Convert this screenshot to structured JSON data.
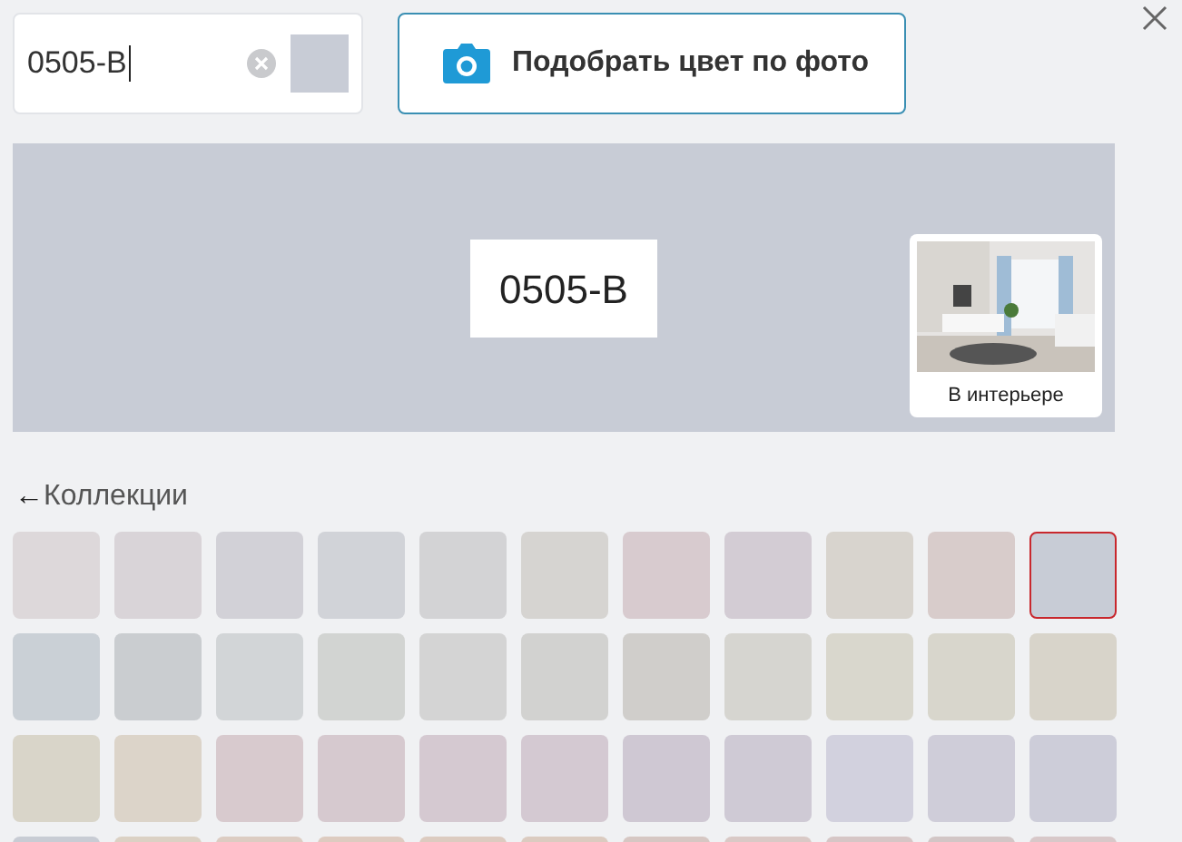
{
  "search": {
    "value": "0505-B"
  },
  "photo_button": {
    "label": "Подобрать цвет по фото"
  },
  "preview": {
    "color": "#c8ccd6",
    "code": "0505-B",
    "interior_label": "В интерьере"
  },
  "back_link": {
    "arrow": "←",
    "label": "Коллекции"
  },
  "swatches": [
    {
      "color": "#ddd8da",
      "selected": false
    },
    {
      "color": "#d9d4d8",
      "selected": false
    },
    {
      "color": "#d2d1d7",
      "selected": false
    },
    {
      "color": "#d1d3d8",
      "selected": false
    },
    {
      "color": "#d3d3d5",
      "selected": false
    },
    {
      "color": "#d6d4d1",
      "selected": false
    },
    {
      "color": "#d8cbcf",
      "selected": false
    },
    {
      "color": "#d3ccd4",
      "selected": false
    },
    {
      "color": "#d8d4ce",
      "selected": false
    },
    {
      "color": "#d8cccb",
      "selected": false
    },
    {
      "color": "#c8ccd6",
      "selected": true
    },
    {
      "color": "#cad0d6",
      "selected": false
    },
    {
      "color": "#cacdd0",
      "selected": false
    },
    {
      "color": "#d2d5d7",
      "selected": false
    },
    {
      "color": "#d2d4d2",
      "selected": false
    },
    {
      "color": "#d4d4d4",
      "selected": false
    },
    {
      "color": "#d2d2d0",
      "selected": false
    },
    {
      "color": "#d0cecb",
      "selected": false
    },
    {
      "color": "#d6d5d0",
      "selected": false
    },
    {
      "color": "#d9d7cd",
      "selected": false
    },
    {
      "color": "#d8d6cc",
      "selected": false
    },
    {
      "color": "#d8d4ca",
      "selected": false
    },
    {
      "color": "#d9d5c9",
      "selected": false
    },
    {
      "color": "#dcd4c9",
      "selected": false
    },
    {
      "color": "#d8cace",
      "selected": false
    },
    {
      "color": "#d6c9cf",
      "selected": false
    },
    {
      "color": "#d5c9d1",
      "selected": false
    },
    {
      "color": "#d4c9d2",
      "selected": false
    },
    {
      "color": "#cfc8d3",
      "selected": false
    },
    {
      "color": "#cfcad5",
      "selected": false
    },
    {
      "color": "#d2d1de",
      "selected": false
    },
    {
      "color": "#cfcdd9",
      "selected": false
    },
    {
      "color": "#cdcdd9",
      "selected": false
    },
    {
      "color": "#c8ccd4",
      "selected": false
    },
    {
      "color": "#dbd1c4",
      "selected": false
    },
    {
      "color": "#dcccc2",
      "selected": false
    },
    {
      "color": "#ddcbc0",
      "selected": false
    },
    {
      "color": "#dccbc0",
      "selected": false
    },
    {
      "color": "#dbcbc0",
      "selected": false
    },
    {
      "color": "#d6c7c3",
      "selected": false
    },
    {
      "color": "#d9c9c6",
      "selected": false
    },
    {
      "color": "#d6c6c6",
      "selected": false
    },
    {
      "color": "#d2c6c6",
      "selected": false
    },
    {
      "color": "#d8c8c9",
      "selected": false
    }
  ]
}
